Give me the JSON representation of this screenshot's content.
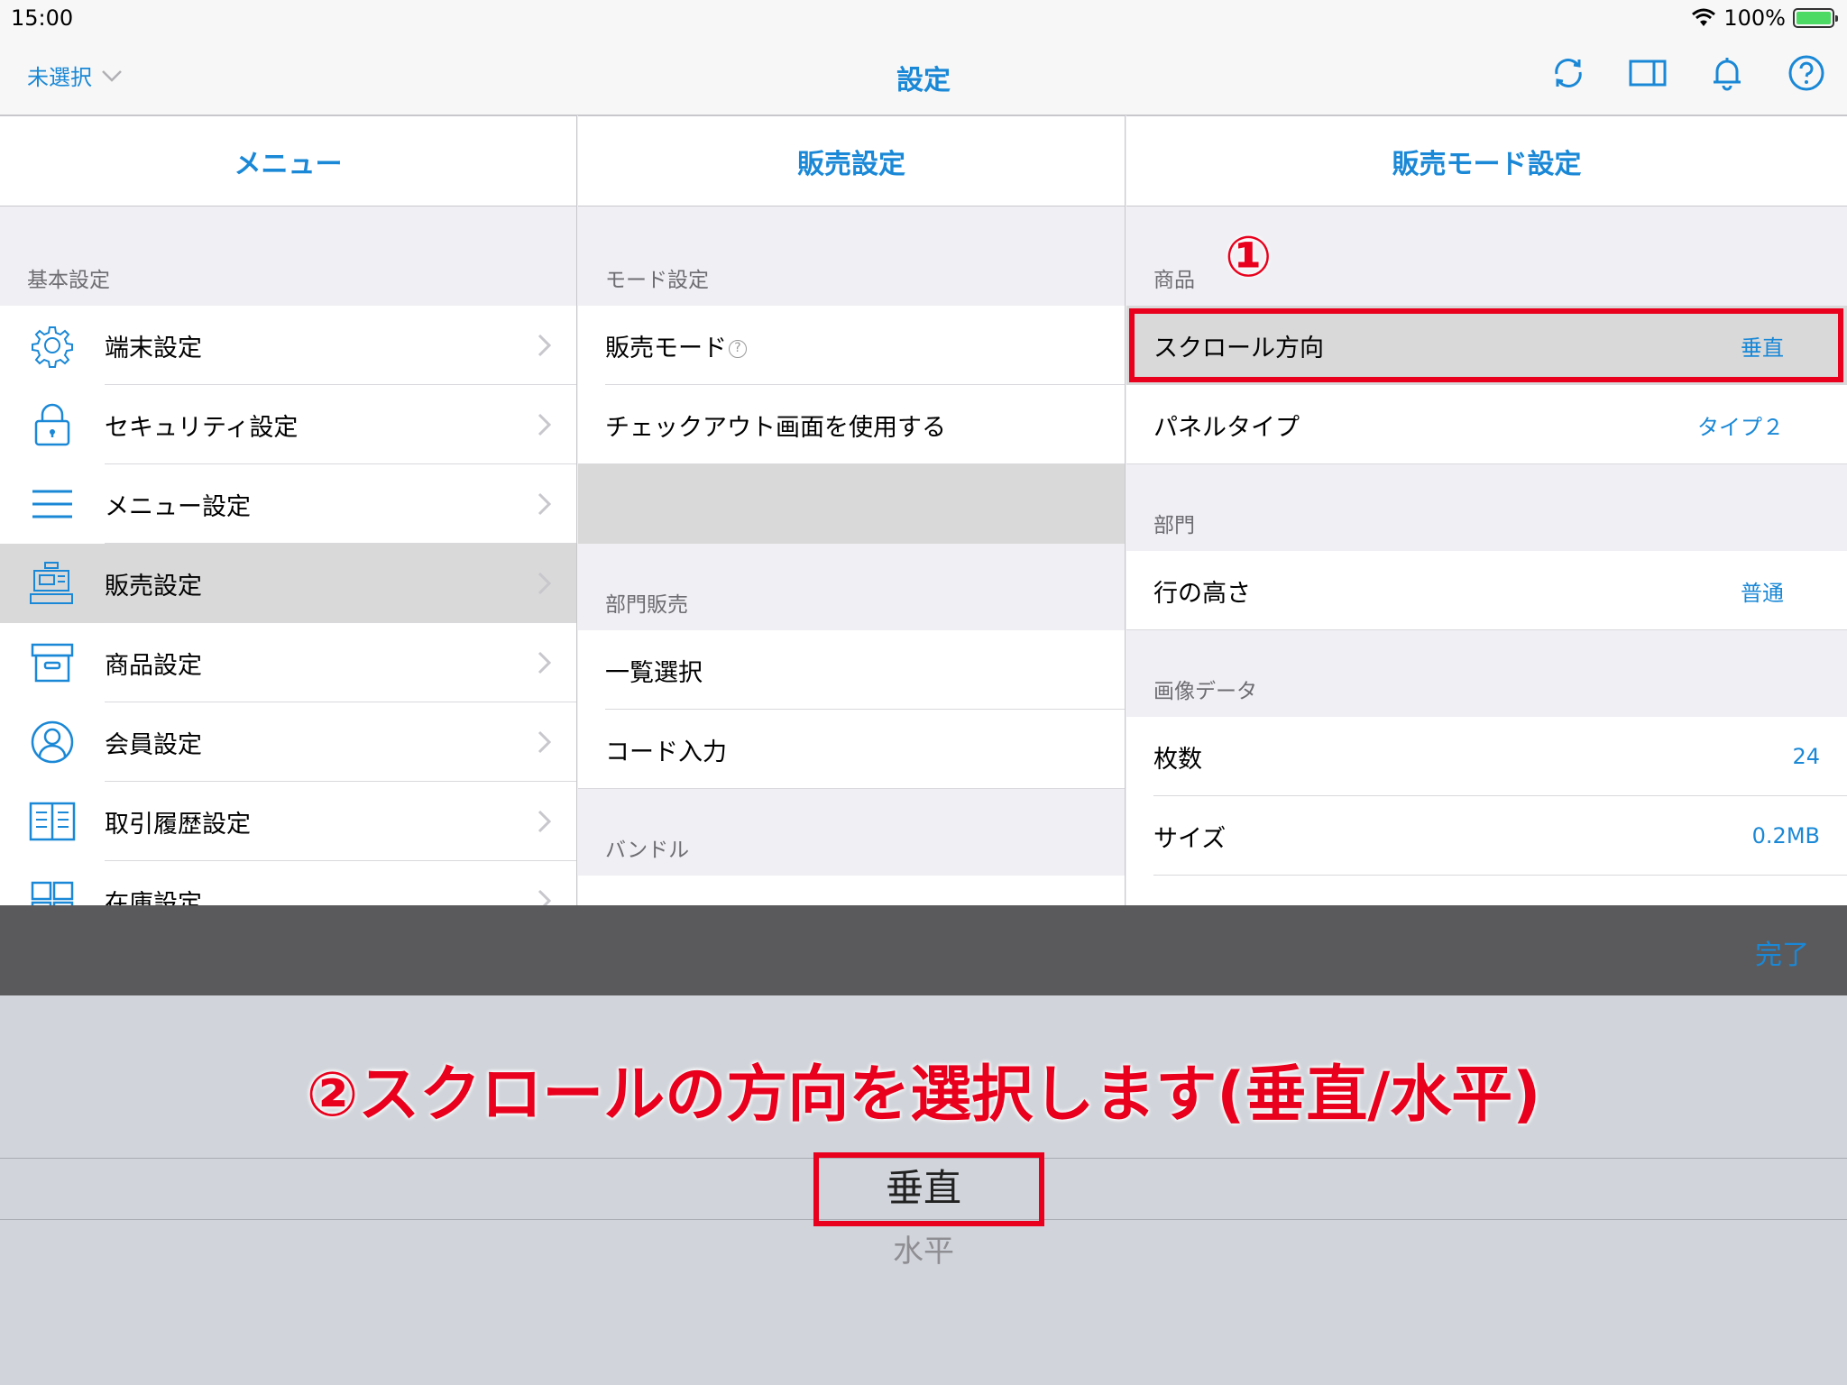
{
  "status_bar": {
    "time": "15:00",
    "battery": "100%"
  },
  "navbar": {
    "left_label": "未選択",
    "title": "設定"
  },
  "menu": {
    "header": "メニュー",
    "section": "基本設定",
    "items": [
      {
        "label": "端末設定",
        "icon": "gear-icon"
      },
      {
        "label": "セキュリティ設定",
        "icon": "lock-icon"
      },
      {
        "label": "メニュー設定",
        "icon": "menu-lines-icon"
      },
      {
        "label": "販売設定",
        "icon": "register-icon"
      },
      {
        "label": "商品設定",
        "icon": "box-icon"
      },
      {
        "label": "会員設定",
        "icon": "person-icon"
      },
      {
        "label": "取引履歴設定",
        "icon": "book-icon"
      },
      {
        "label": "在庫設定",
        "icon": "shelf-icon"
      }
    ]
  },
  "sales": {
    "header": "販売設定",
    "section_mode": "モード設定",
    "mode_items": [
      "販売モード",
      "チェックアウト画面を使用する"
    ],
    "section_dept": "部門販売",
    "dept_items": [
      "一覧選択",
      "コード入力"
    ],
    "section_bundle": "バンドル"
  },
  "sales_mode": {
    "header": "販売モード設定",
    "section_product": "商品",
    "product_items": [
      {
        "label": "スクロール方向",
        "value": "垂直"
      },
      {
        "label": "パネルタイプ",
        "value": "タイプ２"
      }
    ],
    "section_dept": "部門",
    "dept_items": [
      {
        "label": "行の高さ",
        "value": "普通"
      }
    ],
    "section_image": "画像データ",
    "image_items": [
      {
        "label": "枚数",
        "value": "24"
      },
      {
        "label": "サイズ",
        "value": "0.2MB"
      }
    ]
  },
  "annotations": {
    "step1": "①",
    "step2": "②スクロールの方向を選択します(垂直/水平)"
  },
  "picker": {
    "done_label": "完了",
    "selected": "垂直",
    "other": "水平"
  },
  "colors": {
    "accent": "#1a88d6",
    "annotation": "#e8001c"
  }
}
